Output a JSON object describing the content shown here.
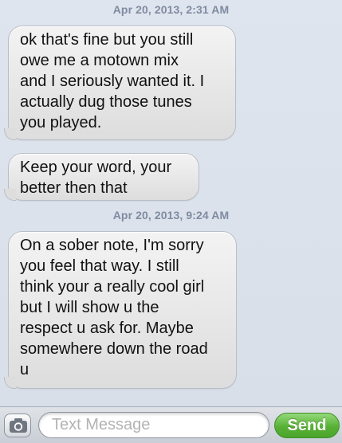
{
  "thread": {
    "timestamps": [
      "Apr 20, 2013, 2:31 AM",
      "Apr 20, 2013, 9:24 AM"
    ],
    "messages": [
      {
        "sender": "received",
        "text": "ok that's fine but you still\nowe me a motown mix\nand I seriously wanted it. I\nactually dug those tunes\nyou played."
      },
      {
        "sender": "received",
        "text": "Keep your word, your\nbetter then that"
      },
      {
        "sender": "received",
        "text": "On a sober note, I'm sorry\nyou feel that way. I still\nthink your a really cool girl\nbut I will show u the\nrespect u ask for. Maybe\nsomewhere down the road\nu"
      }
    ]
  },
  "composer": {
    "camera_icon": "camera-icon",
    "placeholder": "Text Message",
    "send_label": "Send"
  },
  "colors": {
    "background": "#dbe2ec",
    "timestamp": "#7f8ba0",
    "bubble": "#e6e6e6",
    "send_green": "#58b136"
  }
}
